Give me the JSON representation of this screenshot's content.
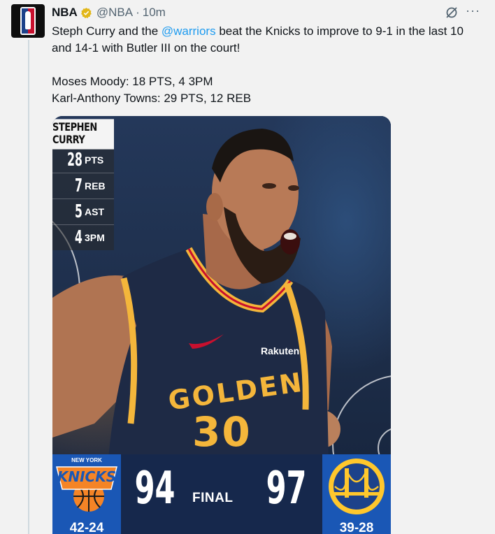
{
  "tweet": {
    "author_name": "NBA",
    "handle": "@NBA",
    "separator": "·",
    "time": "10m",
    "text_pre_link": "Steph Curry and the ",
    "link": "@warriors",
    "text_post_link": " beat the Knicks to improve to 9-1 in the last 10 and 14-1 with Butler III on the court!",
    "line_moody": "Moses Moody: 18 PTS, 4 3PM",
    "line_towns": "Karl-Anthony Towns: 29 PTS, 12 REB",
    "more_label": "···"
  },
  "stat_card": {
    "player": "STEPHEN CURRY",
    "stats": [
      {
        "num": "28",
        "label": "PTS"
      },
      {
        "num": "7",
        "label": "REB"
      },
      {
        "num": "5",
        "label": "AST"
      },
      {
        "num": "4",
        "label": "3PM"
      }
    ]
  },
  "jersey": {
    "text": "GOLDEN",
    "number": "30",
    "sponsor": "Rakuten"
  },
  "scoreboard": {
    "home_team_logo_text": "KNICKS",
    "home_team_logo_top": "NEW YORK",
    "home_score": "94",
    "status": "FINAL",
    "away_score": "97",
    "home_record": "42-24",
    "away_record": "39-28"
  },
  "colors": {
    "link": "#1d9bf0",
    "verified": "#e2b719",
    "knicks_blue": "#1a57b5",
    "warriors_gold": "#ffc72c"
  },
  "icons": [
    "nba-logo-icon",
    "verified-badge-icon",
    "grok-icon",
    "more-icon"
  ]
}
